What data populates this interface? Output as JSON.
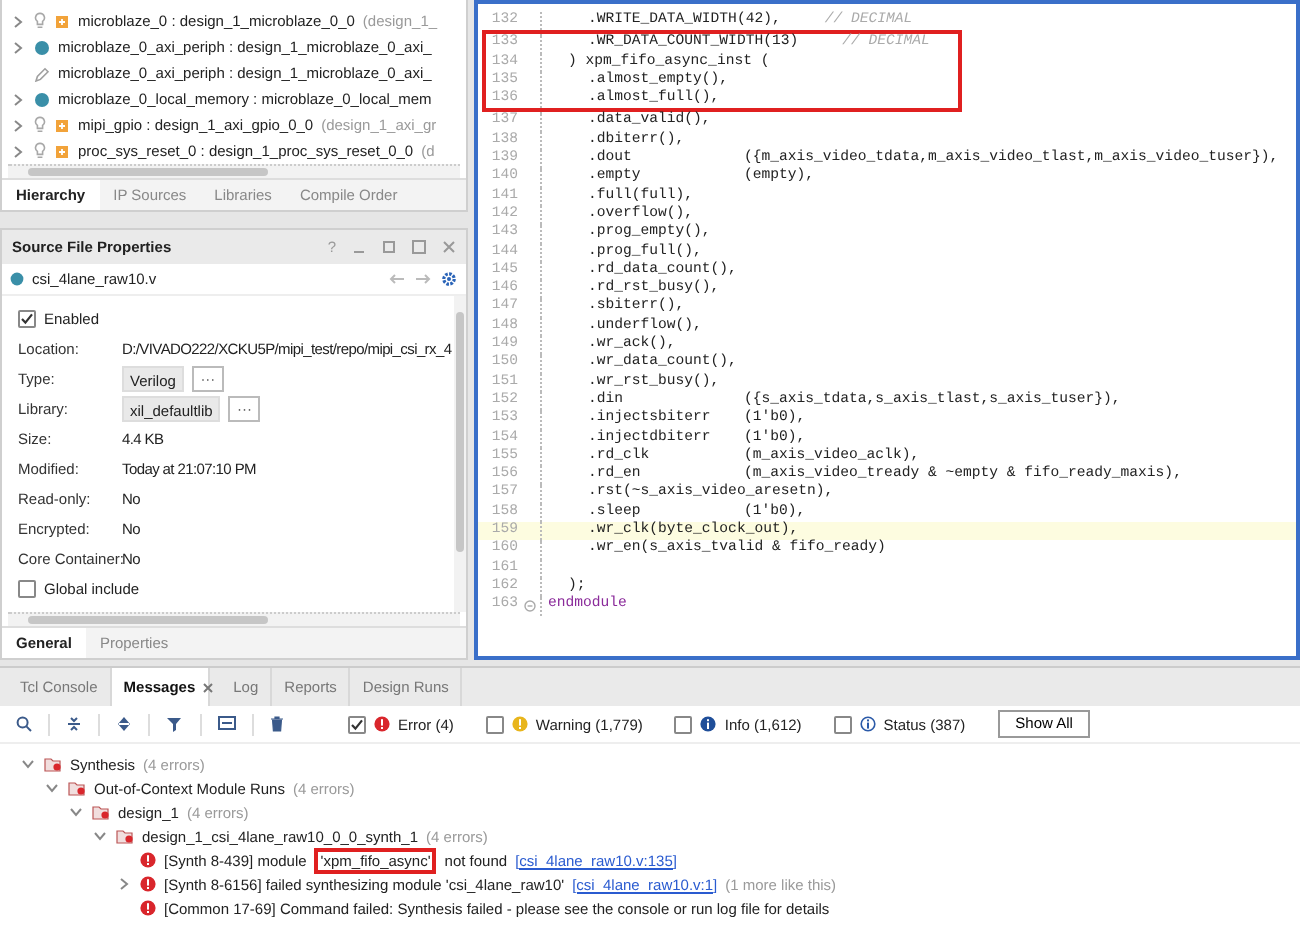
{
  "hierarchy": {
    "rows": [
      {
        "kind": "ip",
        "expanded": false,
        "name": "microblaze_0 : design_1_microblaze_0_0",
        "detail": "(design_1_"
      },
      {
        "kind": "block",
        "expanded": false,
        "name": "microblaze_0_axi_periph : design_1_microblaze_0_axi_"
      },
      {
        "kind": "constraint",
        "name": "microblaze_0_axi_periph : design_1_microblaze_0_axi_"
      },
      {
        "kind": "block",
        "expanded": false,
        "name": "microblaze_0_local_memory : microblaze_0_local_mem"
      },
      {
        "kind": "ip",
        "expanded": false,
        "name": "mipi_gpio : design_1_axi_gpio_0_0",
        "detail": "(design_1_axi_gr"
      },
      {
        "kind": "ip",
        "expanded": false,
        "name": "proc_sys_reset_0 : design_1_proc_sys_reset_0_0",
        "detail": "(d"
      }
    ],
    "tabs": [
      {
        "label": "Hierarchy",
        "selected": true
      },
      {
        "label": "IP Sources",
        "selected": false
      },
      {
        "label": "Libraries",
        "selected": false
      },
      {
        "label": "Compile Order",
        "selected": false
      }
    ]
  },
  "properties": {
    "title": "Source File Properties",
    "help": "?",
    "file": "csi_4lane_raw10.v",
    "enabled": {
      "label": "Enabled",
      "checked": true
    },
    "fields": [
      {
        "kind": "text",
        "label": "Location:",
        "value": "D:/VIVADO222/XCKU5P/mipi_test/repo/mipi_csi_rx_4"
      },
      {
        "kind": "choice",
        "label": "Type:",
        "value": "Verilog",
        "button": "···"
      },
      {
        "kind": "choice",
        "label": "Library:",
        "value": "xil_defaultlib",
        "button": "···"
      },
      {
        "kind": "text",
        "label": "Size:",
        "value": "4.4 KB"
      },
      {
        "kind": "text",
        "label": "Modified:",
        "value": "Today at 21:07:10 PM"
      },
      {
        "kind": "text",
        "label": "Read-only:",
        "value": "No"
      },
      {
        "kind": "text",
        "label": "Encrypted:",
        "value": "No"
      },
      {
        "kind": "text",
        "label": "Core Container:",
        "value": "No"
      }
    ],
    "global_include": {
      "label": "Global include",
      "checked": false
    },
    "tabs": [
      {
        "label": "General",
        "selected": true
      },
      {
        "label": "Properties",
        "selected": false
      }
    ]
  },
  "editor": {
    "lines": [
      {
        "number": "132",
        "kind": "param",
        "code": ".WRITE_DATA_WIDTH(42),",
        "comment": "// DECIMAL",
        "boxed": false,
        "current": false
      },
      {
        "number": "133",
        "kind": "param",
        "code": ".WR_DATA_COUNT_WIDTH(13)",
        "comment": "// DECIMAL",
        "boxed": true,
        "current": false
      },
      {
        "number": "134",
        "kind": "header",
        "code": ") xpm_fifo_async_inst (",
        "boxed": true,
        "current": false
      },
      {
        "number": "135",
        "kind": "port",
        "code": ".almost_empty(),",
        "boxed": true,
        "current": false
      },
      {
        "number": "136",
        "kind": "port",
        "code": ".almost_full(),",
        "boxed": true,
        "current": false
      },
      {
        "number": "137",
        "kind": "port",
        "code": ".data_valid(),",
        "boxed": false,
        "current": false
      },
      {
        "number": "138",
        "kind": "port",
        "code": ".dbiterr(),",
        "boxed": false,
        "current": false
      },
      {
        "number": "139",
        "kind": "port",
        "code": ".dout",
        "value": "({m_axis_video_tdata,m_axis_video_tlast,m_axis_video_tuser}),",
        "boxed": false,
        "current": false
      },
      {
        "number": "140",
        "kind": "port",
        "code": ".empty",
        "value": "(empty),",
        "boxed": false,
        "current": false
      },
      {
        "number": "141",
        "kind": "port",
        "code": ".full(full),",
        "boxed": false,
        "current": false
      },
      {
        "number": "142",
        "kind": "port",
        "code": ".overflow(),",
        "boxed": false,
        "current": false
      },
      {
        "number": "143",
        "kind": "port",
        "code": ".prog_empty(),",
        "boxed": false,
        "current": false
      },
      {
        "number": "144",
        "kind": "port",
        "code": ".prog_full(),",
        "boxed": false,
        "current": false
      },
      {
        "number": "145",
        "kind": "port",
        "code": ".rd_data_count(),",
        "boxed": false,
        "current": false
      },
      {
        "number": "146",
        "kind": "port",
        "code": ".rd_rst_busy(),",
        "boxed": false,
        "current": false
      },
      {
        "number": "147",
        "kind": "port",
        "code": ".sbiterr(),",
        "boxed": false,
        "current": false
      },
      {
        "number": "148",
        "kind": "port",
        "code": ".underflow(),",
        "boxed": false,
        "current": false
      },
      {
        "number": "149",
        "kind": "port",
        "code": ".wr_ack(),",
        "boxed": false,
        "current": false
      },
      {
        "number": "150",
        "kind": "port",
        "code": ".wr_data_count(),",
        "boxed": false,
        "current": false
      },
      {
        "number": "151",
        "kind": "port",
        "code": ".wr_rst_busy(),",
        "boxed": false,
        "current": false
      },
      {
        "number": "152",
        "kind": "port",
        "code": ".din",
        "value": "({s_axis_tdata,s_axis_tlast,s_axis_tuser}),",
        "boxed": false,
        "current": false
      },
      {
        "number": "153",
        "kind": "port",
        "code": ".injectsbiterr",
        "value": "(1'b0),",
        "boxed": false,
        "current": false
      },
      {
        "number": "154",
        "kind": "port",
        "code": ".injectdbiterr",
        "value": "(1'b0),",
        "boxed": false,
        "current": false
      },
      {
        "number": "155",
        "kind": "port",
        "code": ".rd_clk",
        "value": "(m_axis_video_aclk),",
        "boxed": false,
        "current": false
      },
      {
        "number": "156",
        "kind": "port",
        "code": ".rd_en",
        "value": "(m_axis_video_tready & ~empty & fifo_ready_maxis),",
        "boxed": false,
        "current": false
      },
      {
        "number": "157",
        "kind": "port",
        "code": ".rst(~s_axis_video_aresetn),",
        "boxed": false,
        "current": false
      },
      {
        "number": "158",
        "kind": "port",
        "code": ".sleep",
        "value": "(1'b0),",
        "boxed": false,
        "current": false
      },
      {
        "number": "159",
        "kind": "port",
        "code": ".wr_clk(byte_clock_out),",
        "boxed": false,
        "current": true
      },
      {
        "number": "160",
        "kind": "port",
        "code": ".wr_en(s_axis_tvalid & fifo_ready)",
        "boxed": false,
        "current": false
      },
      {
        "number": "161",
        "kind": "blank",
        "boxed": false,
        "current": false
      },
      {
        "number": "162",
        "kind": "header",
        "code": ");",
        "boxed": false,
        "current": false
      },
      {
        "number": "163",
        "kind": "keyword",
        "code": "endmodule",
        "boxed": false,
        "current": false
      }
    ]
  },
  "messages": {
    "tabs": [
      {
        "label": "Tcl Console",
        "selected": false
      },
      {
        "label": "Messages",
        "selected": true,
        "closable": true
      },
      {
        "label": "Log",
        "selected": false
      },
      {
        "label": "Reports",
        "selected": false
      },
      {
        "label": "Design Runs",
        "selected": false
      }
    ],
    "filters": [
      {
        "kind": "error",
        "label": "Error (4)",
        "checked": true
      },
      {
        "kind": "warning",
        "label": "Warning (1,779)",
        "checked": false
      },
      {
        "kind": "info",
        "label": "Info (1,612)",
        "checked": false
      },
      {
        "kind": "status",
        "label": "Status (387)",
        "checked": false
      }
    ],
    "show_all": "Show All",
    "tree": [
      {
        "kind": "group",
        "label": "Synthesis",
        "count": "(4 errors)",
        "expanded": true,
        "children": [
          {
            "kind": "group",
            "label": "Out-of-Context Module Runs",
            "count": "(4 errors)",
            "expanded": true,
            "children": [
              {
                "kind": "group",
                "label": "design_1",
                "count": "(4 errors)",
                "expanded": true,
                "children": [
                  {
                    "kind": "group",
                    "label": "design_1_csi_4lane_raw10_0_0_synth_1",
                    "count": "(4 errors)",
                    "expanded": true,
                    "children": [
                      {
                        "kind": "error",
                        "parts": [
                          {
                            "text": "[Synth 8-439] module",
                            "boxed": false
                          },
                          {
                            "text": "'xpm_fifo_async'",
                            "boxed": true
                          },
                          {
                            "text": "not found",
                            "boxed": false
                          }
                        ],
                        "link": "[csi_4lane_raw10.v:135]"
                      },
                      {
                        "kind": "error",
                        "expanded": false,
                        "parts": [
                          {
                            "text": "[Synth 8-6156] failed synthesizing module 'csi_4lane_raw10'",
                            "boxed": false
                          }
                        ],
                        "link": "[csi_4lane_raw10.v:1]",
                        "extra": "(1 more like this)"
                      },
                      {
                        "kind": "error",
                        "parts": [
                          {
                            "text": "[Common 17-69] Command failed: Synthesis failed - please see the console or run log file for details",
                            "boxed": false
                          }
                        ]
                      }
                    ]
                  }
                ]
              }
            ]
          }
        ]
      }
    ]
  }
}
